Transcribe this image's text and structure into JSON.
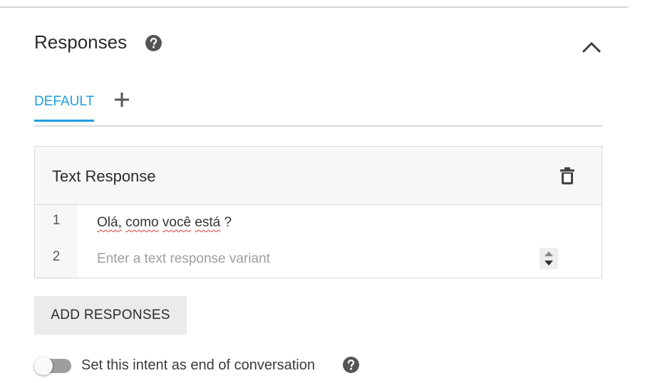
{
  "section": {
    "title": "Responses",
    "help_icon": "question-circle-icon",
    "collapse_icon": "chevron-up-icon"
  },
  "tabs": {
    "items": [
      {
        "label": "DEFAULT",
        "active": true
      }
    ],
    "add_icon": "plus-icon"
  },
  "card": {
    "title": "Text Response",
    "delete_icon": "trash-icon",
    "rows": [
      {
        "num": "1",
        "text_words": [
          "Olá,",
          "como",
          "você",
          "está"
        ],
        "text_tail": " ?"
      },
      {
        "num": "2",
        "placeholder": "Enter a text response variant"
      }
    ],
    "stepper_icon": "spinner-arrows-icon"
  },
  "add_button": {
    "label": "ADD RESPONSES"
  },
  "end_conversation": {
    "label": "Set this intent as end of conversation",
    "enabled": false,
    "help_icon": "question-circle-icon"
  },
  "colors": {
    "accent": "#1e9ee0",
    "text": "#2b2b2b",
    "placeholder": "#9e9e9e",
    "spellcheck": "#e53935"
  }
}
